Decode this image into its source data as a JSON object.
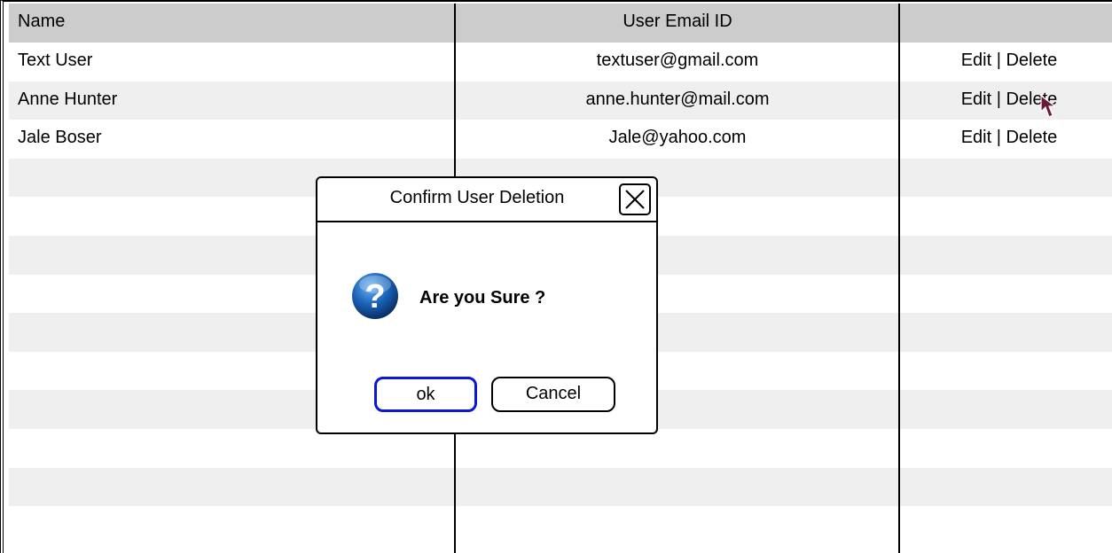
{
  "table": {
    "headers": [
      "Name",
      "User Email ID",
      ""
    ],
    "rows": [
      {
        "name": "Text User",
        "email": "textuser@gmail.com",
        "edit": "Edit",
        "divider": "|",
        "delete": "Delete"
      },
      {
        "name": "Anne Hunter",
        "email": "anne.hunter@mail.com",
        "edit": "Edit",
        "divider": "|",
        "delete": "Delete"
      },
      {
        "name": "Jale Boser",
        "email": "Jale@yahoo.com",
        "edit": "Edit",
        "divider": "|",
        "delete": "Delete"
      }
    ],
    "empty_row_count": 10
  },
  "dialog": {
    "title": "Confirm User Deletion",
    "message": "Are you Sure ?",
    "ok_label": "ok",
    "cancel_label": "Cancel",
    "icon": "question-icon",
    "close_icon": "close-icon"
  },
  "colors": {
    "header_bg": "#cccccc",
    "alt_row_bg": "#efefef",
    "ok_border": "#0a17d8",
    "cursor": "#6b1a3a",
    "question_icon": "#1a63b8"
  }
}
